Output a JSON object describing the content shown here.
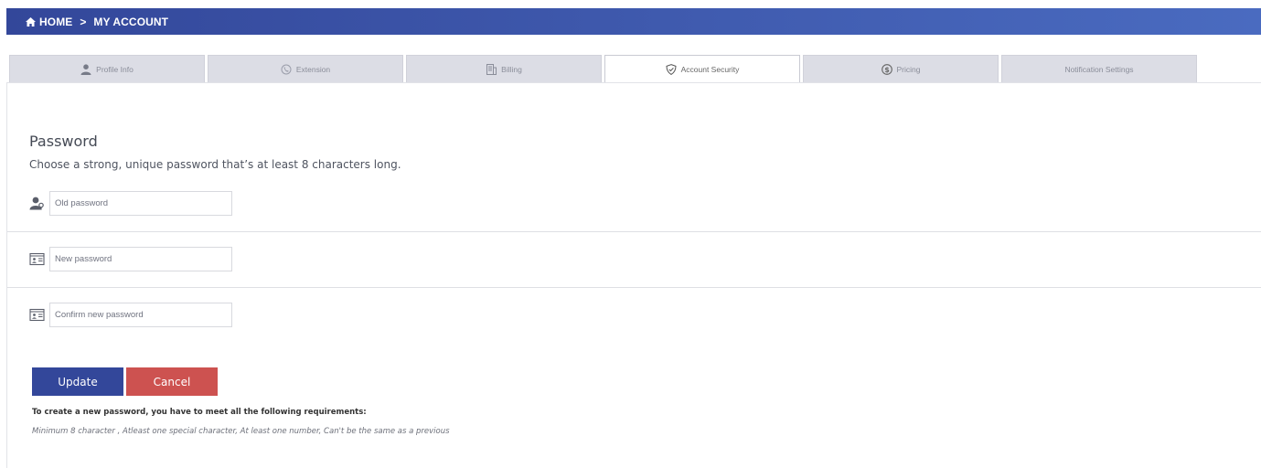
{
  "breadcrumb": {
    "home_label": "HOME",
    "separator": ">",
    "current_label": "MY ACCOUNT"
  },
  "tabs": [
    {
      "label": "Profile Info",
      "icon": "user-icon"
    },
    {
      "label": "Extension",
      "icon": "phone-globe-icon"
    },
    {
      "label": "Billing",
      "icon": "invoice-icon"
    },
    {
      "label": "Account Security",
      "icon": "shield-check-icon",
      "active": true
    },
    {
      "label": "Pricing",
      "icon": "dollar-circle-icon"
    },
    {
      "label": "Notification Settings"
    }
  ],
  "password": {
    "title": "Password",
    "description": "Choose a strong, unique password that’s at least 8 characters long.",
    "fields": {
      "old_placeholder": "Old password",
      "new_placeholder": "New password",
      "confirm_placeholder": "Confirm new password"
    }
  },
  "actions": {
    "update_label": "Update",
    "cancel_label": "Cancel"
  },
  "requirements": {
    "title": "To create a new password, you have to meet all the following requirements:",
    "list": "Minimum 8 character , Atleast one special character, At least one number, Can't be the same as a previous"
  },
  "colors": {
    "primary": "#33479a",
    "danger": "#cd5250",
    "tab_bg": "#dcdde5"
  }
}
